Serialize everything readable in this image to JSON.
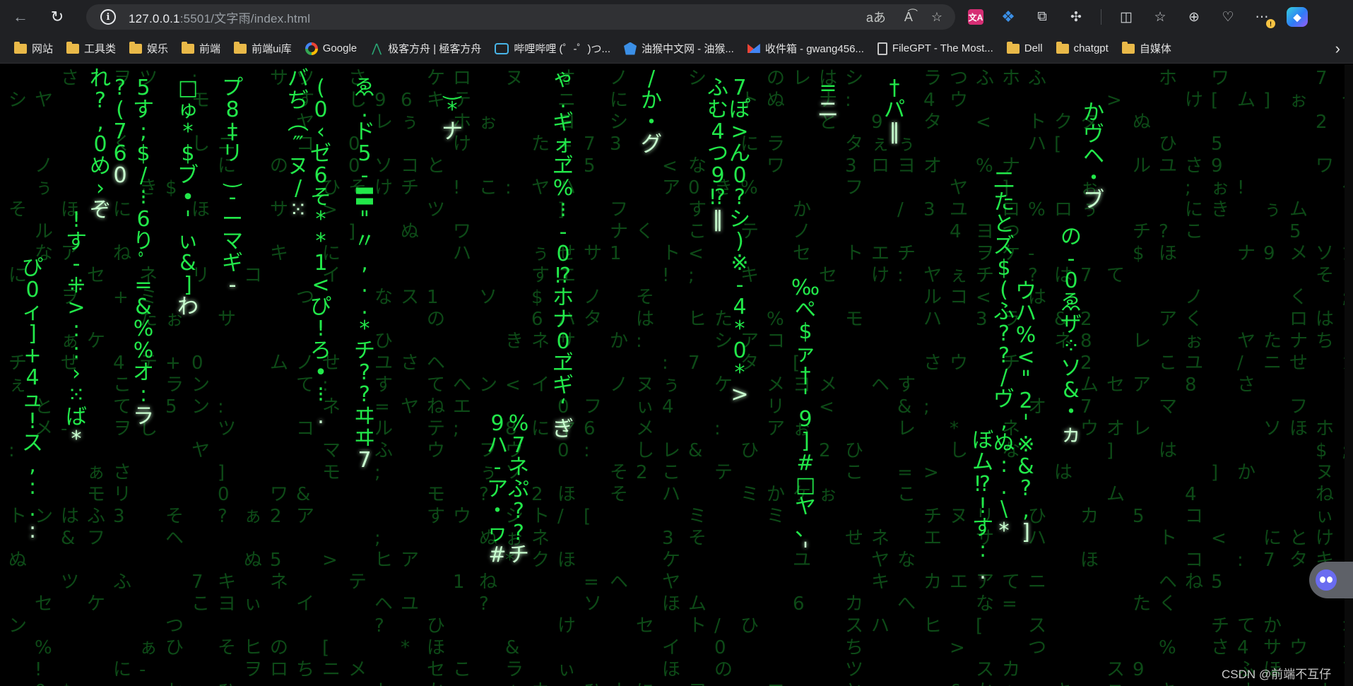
{
  "browser": {
    "url_host": "127.0.0.1",
    "url_rest": ":5501/文字雨/index.html",
    "read_aloud_label": "aあ",
    "toolbar_icons": [
      "translate-icon",
      "extension-blue-icon",
      "collections-icon",
      "extensions-icon",
      "split-screen-icon",
      "favorites-icon",
      "tab-actions-icon",
      "performance-icon",
      "menu-icon",
      "copilot-icon"
    ]
  },
  "bookmarks": [
    {
      "label": "网站",
      "icon": "folder-icon"
    },
    {
      "label": "工具类",
      "icon": "folder-icon"
    },
    {
      "label": "娱乐",
      "icon": "folder-icon"
    },
    {
      "label": "前端",
      "icon": "folder-icon"
    },
    {
      "label": "前端ui库",
      "icon": "folder-icon"
    },
    {
      "label": "Google",
      "icon": "google-icon"
    },
    {
      "label": "极客方舟 | 極客方舟",
      "icon": "geek-icon"
    },
    {
      "label": "哔哩哔哩 (゜-゜)つ...",
      "icon": "bilibili-icon"
    },
    {
      "label": "油猴中文网 - 油猴...",
      "icon": "tampermonkey-icon"
    },
    {
      "label": "收件箱 - gwang456...",
      "icon": "gmail-icon"
    },
    {
      "label": "FileGPT - The Most...",
      "icon": "file-icon"
    },
    {
      "label": "Dell",
      "icon": "folder-icon"
    },
    {
      "label": "chatgpt",
      "icon": "folder-icon"
    },
    {
      "label": "自媒体",
      "icon": "folder-icon"
    }
  ],
  "matrix": {
    "bright_color": "#22e84a",
    "dim_color": "#0d4a17",
    "glow_color": "#c9ffd0",
    "columns": [
      {
        "chars": "ぴ0ィ]+4ュ!ス,:.:"
      },
      {
        "chars": "れ?,0め›ぞ"
      },
      {
        "chars": "?(760"
      },
      {
        "chars": "!す-⁜>::›⁙ば*"
      },
      {
        "chars": "5す;$/⁝6りﾟ=&%%オ:ラ"
      },
      {
        "chars": "□ゅ*$ブ•'ぃ&]わ"
      },
      {
        "chars": "プ8‡リ‿-ーマギ-"
      },
      {
        "chars": "バぢ︵‴ヌ/⁙"
      },
      {
        "chars": "(0‹ゼ6そ**1<ぴ!ろ•⁝."
      },
      {
        "chars": "ゑ.ド5-〓\"〃,..*チ??ヰヰ7"
      },
      {
        "chars": "‿*ナ"
      },
      {
        "chars": "9ハ-ア・ヮ#"
      },
      {
        "chars": "%7ネぷ??チ"
      },
      {
        "chars": "ゃ.ギォヹ%⁝-0⁉ホナ0ヹギ‘ぎ"
      },
      {
        "chars": "/か・グ"
      },
      {
        "chars": "ふむ4つ9⁉‖"
      },
      {
        "chars": "7ぽ>ん0?シ)※-4*0*>"
      },
      {
        "chars": "‰ぺ$ァ†'9]#□ヤ、'"
      },
      {
        "chars": "=ニ"
      },
      {
        "chars": "†パ‖"
      },
      {
        "chars": "二たとズ$(ふ??/ヴ,ぬ:.\\*"
      },
      {
        "chars": "ぼム⁉!す:."
      },
      {
        "chars": "ウハ%<\"2'※&?,]"
      },
      {
        "chars": "の-0ゑザ⁘ソ&・ヵ"
      },
      {
        "chars": "かヴヘ・ブ"
      }
    ]
  },
  "watermark": "CSDN @前端不互仔"
}
